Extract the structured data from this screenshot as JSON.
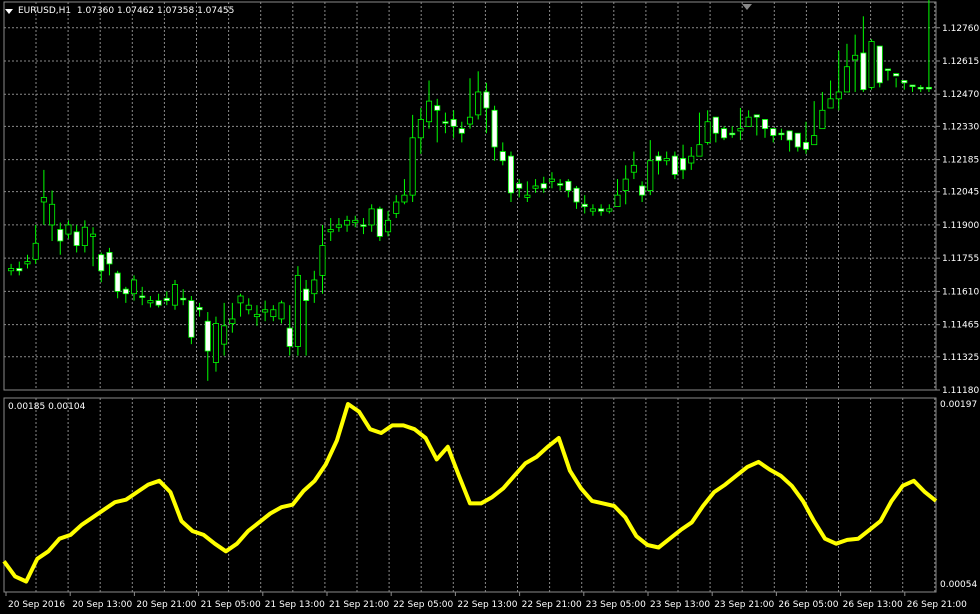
{
  "header": {
    "symbol": "EURUSD,H1",
    "ohlc": "1.07360 1.07462 1.07358 1.07455",
    "indicator_values": "0.00185 0.00104"
  },
  "colors": {
    "background": "#000000",
    "grid": "#8a8a8a",
    "bull_candle": "#ffffff",
    "bear_candle": "#000000",
    "wick": "#00ff00",
    "indicator": "#ffff00",
    "text": "#ffffff"
  },
  "icons": {
    "menu": "triangle-down-icon",
    "scroll_marker": "triangle-down-icon"
  },
  "chart_data": [
    {
      "type": "candlestick",
      "title": "EURUSD,H1",
      "yticks": [
        "1.12760",
        "1.12615",
        "1.12470",
        "1.12330",
        "1.12185",
        "1.12045",
        "1.11900",
        "1.11755",
        "1.11610",
        "1.11465",
        "1.11325",
        "1.11180"
      ],
      "ylim": [
        1.1118,
        1.1282
      ],
      "grid": true,
      "close": [
        1.117,
        1.1171,
        1.1173,
        1.1175,
        1.12,
        1.119,
        1.1188,
        1.1186,
        1.1187,
        1.1181,
        1.1185,
        1.1177,
        1.1178,
        1.1169,
        1.1162,
        1.116,
        1.1159,
        1.1156,
        1.1157,
        1.1158,
        1.1155,
        1.1158,
        1.1157,
        1.1154,
        1.1148,
        1.113,
        1.1138,
        1.1147,
        1.1156,
        1.1153,
        1.115,
        1.1152,
        1.115,
        1.1149,
        1.1145,
        1.1137,
        1.1162,
        1.116,
        1.1168,
        1.1187,
        1.1189,
        1.119,
        1.1191,
        1.119,
        1.119,
        1.1197,
        1.1187,
        1.1195,
        1.12,
        1.1203,
        1.1228,
        1.1235,
        1.1242,
        1.1235,
        1.1236,
        1.1232,
        1.1234,
        1.1238,
        1.1248,
        1.124,
        1.1222,
        1.122,
        1.1208,
        1.1202,
        1.1206,
        1.1208,
        1.1209,
        1.1208,
        1.1209,
        1.1206,
        1.1199,
        1.1196,
        1.1197,
        1.1196,
        1.1198,
        1.1205,
        1.1213,
        1.1207,
        1.1205,
        1.122,
        1.1218,
        1.122,
        1.1219,
        1.1217,
        1.122,
        1.1226,
        1.1237,
        1.1232,
        1.123,
        1.1231,
        1.1233,
        1.1238,
        1.1236,
        1.1232,
        1.123,
        1.1231,
        1.123,
        1.1226,
        1.1225,
        1.1232,
        1.1241,
        1.1245,
        1.1248,
        1.1262,
        1.1265,
        1.125,
        1.1268,
        1.1258,
        1.1256,
        1.1253,
        1.1251,
        1.125,
        1.125
      ],
      "open": [
        1.1171,
        1.117,
        1.1174,
        1.1182,
        1.1202,
        1.1199,
        1.1183,
        1.119,
        1.1181,
        1.1189,
        1.1186,
        1.117,
        1.1173,
        1.1161,
        1.116,
        1.1166,
        1.1159,
        1.1157,
        1.1155,
        1.1157,
        1.1164,
        1.1158,
        1.1141,
        1.1153,
        1.1135,
        1.1147,
        1.1146,
        1.1149,
        1.1159,
        1.1155,
        1.1151,
        1.1153,
        1.1153,
        1.1156,
        1.1137,
        1.1168,
        1.1157,
        1.1166,
        1.1181,
        1.1188,
        1.119,
        1.1192,
        1.1192,
        1.119,
        1.1197,
        1.1185,
        1.1192,
        1.12,
        1.1203,
        1.1228,
        1.1236,
        1.1244,
        1.124,
        1.1235,
        1.1233,
        1.123,
        1.1237,
        1.1248,
        1.1241,
        1.1224,
        1.1218,
        1.1204,
        1.1206,
        1.1203,
        1.1207,
        1.1206,
        1.121,
        1.1208,
        1.1205,
        1.12,
        1.1198,
        1.1197,
        1.1196,
        1.1197,
        1.1203,
        1.121,
        1.1216,
        1.1203,
        1.1218,
        1.1218,
        1.1219,
        1.1212,
        1.1214,
        1.122,
        1.1225,
        1.1235,
        1.123,
        1.1228,
        1.123,
        1.1232,
        1.1237,
        1.1237,
        1.1232,
        1.1229,
        1.123,
        1.1227,
        1.1224,
        1.1223,
        1.1229,
        1.124,
        1.1245,
        1.1248,
        1.1259,
        1.1264,
        1.1249,
        1.127,
        1.1252,
        1.1258,
        1.1255,
        1.1252,
        1.1251,
        1.125,
        1.125,
        1.1249
      ],
      "high": [
        1.1173,
        1.1174,
        1.1177,
        1.119,
        1.1214,
        1.1205,
        1.1191,
        1.1192,
        1.119,
        1.1192,
        1.1189,
        1.1178,
        1.118,
        1.117,
        1.1163,
        1.1168,
        1.1163,
        1.1159,
        1.116,
        1.1161,
        1.1166,
        1.1162,
        1.1159,
        1.1156,
        1.1152,
        1.115,
        1.1156,
        1.1156,
        1.116,
        1.1158,
        1.1155,
        1.1157,
        1.1155,
        1.1157,
        1.1155,
        1.1172,
        1.1166,
        1.117,
        1.119,
        1.1193,
        1.1193,
        1.1194,
        1.1194,
        1.1193,
        1.1199,
        1.1198,
        1.1196,
        1.1203,
        1.121,
        1.1238,
        1.1241,
        1.1253,
        1.1245,
        1.1239,
        1.124,
        1.1235,
        1.1254,
        1.1257,
        1.1252,
        1.1242,
        1.1226,
        1.1222,
        1.121,
        1.1209,
        1.121,
        1.1211,
        1.1213,
        1.121,
        1.121,
        1.1207,
        1.1203,
        1.1199,
        1.1199,
        1.1199,
        1.121,
        1.1216,
        1.1222,
        1.1209,
        1.1227,
        1.1222,
        1.1222,
        1.1222,
        1.1225,
        1.1224,
        1.1239,
        1.124,
        1.1234,
        1.1233,
        1.1233,
        1.1241,
        1.124,
        1.1238,
        1.1234,
        1.1232,
        1.1232,
        1.123,
        1.123,
        1.1235,
        1.1244,
        1.1248,
        1.1253,
        1.1266,
        1.1269,
        1.1273,
        1.1281,
        1.1271,
        1.1262,
        1.1258,
        1.1254,
        1.1252,
        1.1251,
        1.1251
      ],
      "low": [
        1.1168,
        1.1168,
        1.1171,
        1.1173,
        1.119,
        1.1183,
        1.1177,
        1.1184,
        1.1178,
        1.1178,
        1.1172,
        1.1165,
        1.1168,
        1.1158,
        1.1156,
        1.1157,
        1.1155,
        1.1154,
        1.1154,
        1.1155,
        1.1153,
        1.1155,
        1.1138,
        1.115,
        1.1122,
        1.1126,
        1.1133,
        1.1143,
        1.115,
        1.1151,
        1.1146,
        1.1148,
        1.1148,
        1.1147,
        1.1133,
        1.1133,
        1.1133,
        1.1156,
        1.116,
        1.1183,
        1.1187,
        1.1187,
        1.1189,
        1.1186,
        1.1187,
        1.1183,
        1.1185,
        1.1193,
        1.1199,
        1.12,
        1.1221,
        1.1232,
        1.1226,
        1.123,
        1.1228,
        1.1226,
        1.1232,
        1.1236,
        1.123,
        1.1218,
        1.1216,
        1.12,
        1.1202,
        1.12,
        1.1204,
        1.1204,
        1.1206,
        1.1205,
        1.1202,
        1.1197,
        1.1195,
        1.1194,
        1.1194,
        1.1195,
        1.1201,
        1.1199,
        1.121,
        1.12,
        1.1203,
        1.1212,
        1.1216,
        1.121,
        1.121,
        1.1214,
        1.1223,
        1.1225,
        1.1226,
        1.1227,
        1.1228,
        1.1227,
        1.1235,
        1.1229,
        1.1228,
        1.1226,
        1.1227,
        1.1222,
        1.1222,
        1.1221,
        1.1227,
        1.1237,
        1.1242,
        1.124,
        1.1257,
        1.1248,
        1.1248,
        1.1249,
        1.125,
        1.1253,
        1.125,
        1.1249,
        1.1248,
        1.1248,
        1.1248
      ]
    },
    {
      "type": "line",
      "yticks": [
        "0.00197",
        "0.00054"
      ],
      "ylim": [
        0.00054,
        0.00197
      ],
      "grid": true,
      "series": [
        {
          "values": [
            0.00072,
            0.0006,
            0.00056,
            0.00074,
            0.0008,
            0.0009,
            0.00093,
            0.00101,
            0.00107,
            0.00113,
            0.00119,
            0.00121,
            0.00127,
            0.00133,
            0.00136,
            0.00127,
            0.00104,
            0.00096,
            0.00093,
            0.00086,
            0.0008,
            0.00086,
            0.00096,
            0.00103,
            0.0011,
            0.00115,
            0.00117,
            0.00128,
            0.00136,
            0.00149,
            0.00168,
            0.00197,
            0.00191,
            0.00177,
            0.00174,
            0.0018,
            0.0018,
            0.00177,
            0.0017,
            0.00153,
            0.00163,
            0.0014,
            0.00118,
            0.00118,
            0.00123,
            0.0013,
            0.0014,
            0.0015,
            0.00155,
            0.00163,
            0.0017,
            0.00144,
            0.0013,
            0.0012,
            0.00118,
            0.00116,
            0.00107,
            0.00092,
            0.00085,
            0.00083,
            0.0009,
            0.00097,
            0.00103,
            0.00116,
            0.00127,
            0.00133,
            0.0014,
            0.00147,
            0.00151,
            0.00145,
            0.0014,
            0.00132,
            0.0012,
            0.00104,
            0.0009,
            0.00086,
            0.00089,
            0.0009,
            0.00097,
            0.00104,
            0.0012,
            0.00132,
            0.00136,
            0.00127,
            0.0012
          ]
        }
      ],
      "x_ticks": [
        "20 Sep 2016",
        "20 Sep 13:00",
        "20 Sep 21:00",
        "21 Sep 05:00",
        "21 Sep 13:00",
        "21 Sep 21:00",
        "22 Sep 05:00",
        "22 Sep 13:00",
        "22 Sep 21:00",
        "23 Sep 05:00",
        "23 Sep 13:00",
        "23 Sep 21:00",
        "26 Sep 05:00",
        "26 Sep 13:00",
        "26 Sep 21:00"
      ]
    }
  ]
}
